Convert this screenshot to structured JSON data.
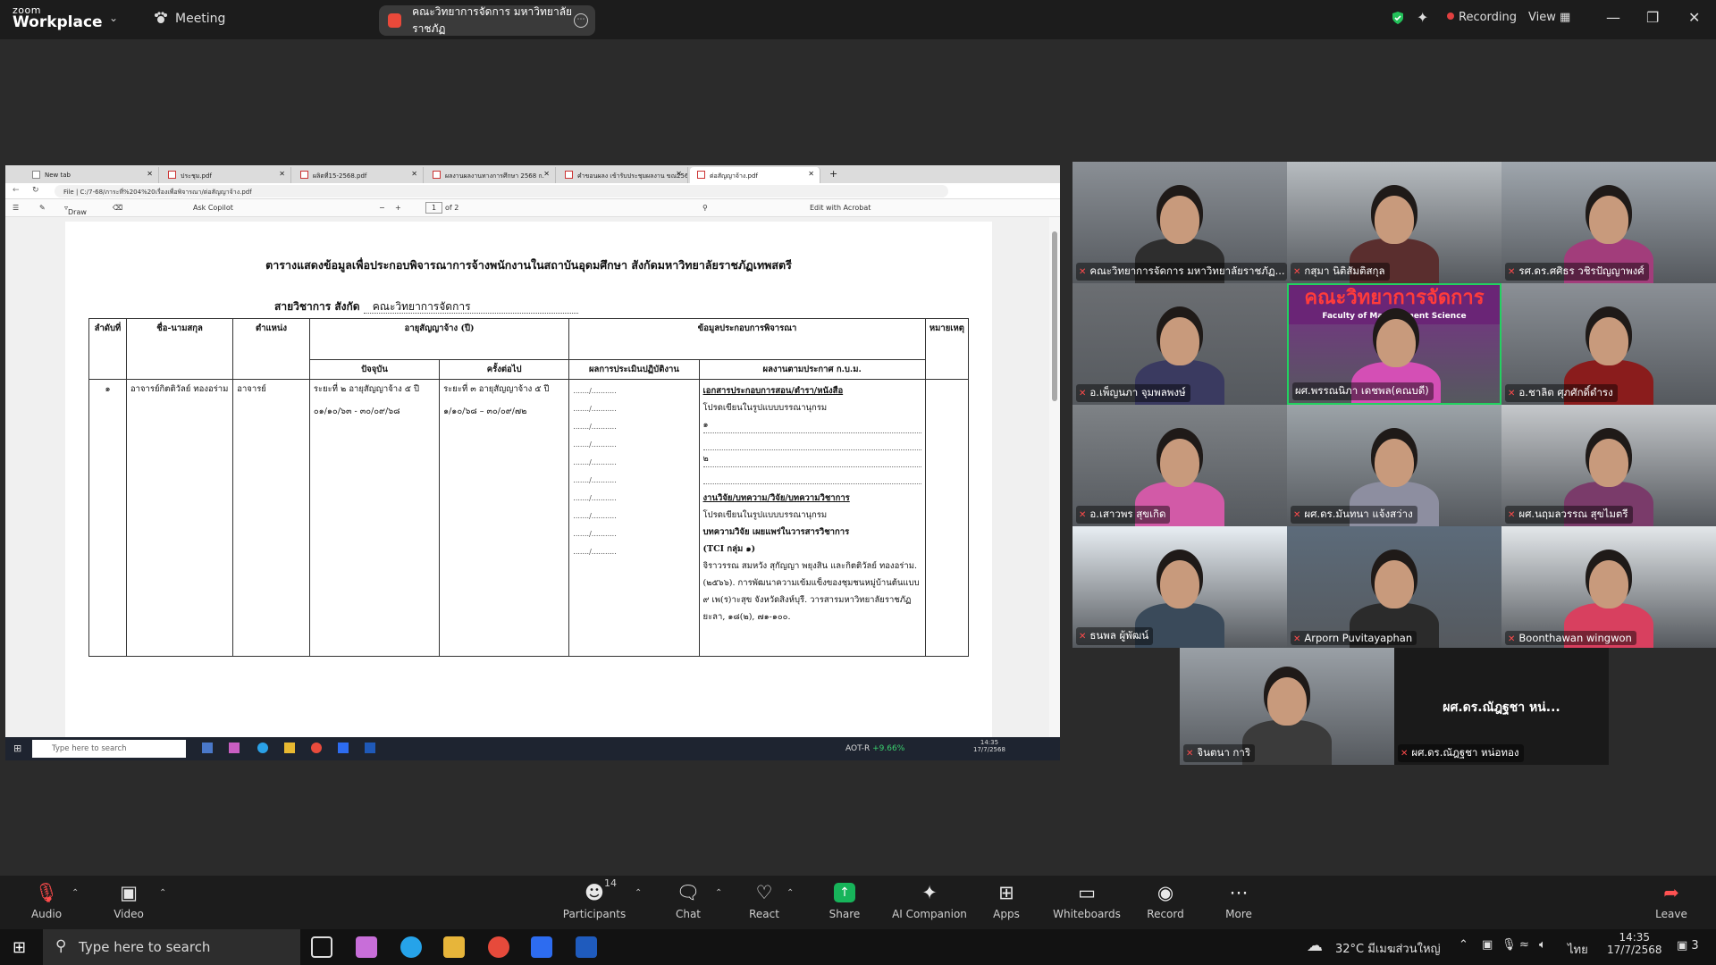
{
  "app": {
    "logo_top": "zoom",
    "logo_bottom": "Workplace",
    "meeting_label": "Meeting",
    "shared_tab_title": "คณะวิทยาการจัดการ มหาวิทยาลัยราชภัฏ",
    "recording_label": "Recording",
    "view_label": "View"
  },
  "browser": {
    "tabs": [
      "New tab",
      "ประชุม.pdf",
      "ผลิตที่15-2568.pdf",
      "ผลงานผลงานทางการศึกษา 2568 ก.",
      "คำขอนผลง เข้ารับประชุมผลงาน ขณ2568",
      "ต่อสัญญาจ้าง.pdf"
    ],
    "url": "C:/7-68/ภาระที่%204%20เรื่องเพื่อพิจารณา/ต่อสัญญาจ้าง.pdf",
    "file_label": "File",
    "draw_label": "Draw",
    "ask_copilot": "Ask Copilot",
    "page_num": "1",
    "page_of": "of 2",
    "edit_acrobat": "Edit with Acrobat"
  },
  "document": {
    "title": "ตารางแสดงข้อมูลเพื่อประกอบพิจารณาการจ้างพนักงานในสถาบันอุดมศึกษา สังกัดมหาวิทยาลัยราชภัฏเทพสตรี",
    "subtitle_prefix": "สายวิชาการ    สังกัด",
    "subtitle_value": "คณะวิทยาการจัดการ",
    "headers": {
      "order": "ลำดับที่",
      "name": "ชื่อ-นามสกุล",
      "position": "ตำแหน่ง",
      "contract": "อายุสัญญาจ้าง (ปี)",
      "current": "ปัจจุบัน",
      "next": "ครั้งต่อไป",
      "consider": "ข้อมูลประกอบการพิจารณา",
      "eval": "ผลการประเมินปฏิบัติงาน",
      "works": "ผลงานตามประกาศ ก.บ.ม.",
      "remark": "หมายเหตุ"
    },
    "row": {
      "order": "๑",
      "name": "อาจารย์กิตติวัลย์ ทองอร่าม",
      "position": "อาจารย์",
      "current_term": "ระยะที่ ๒ อายุสัญญาจ้าง ๕ ปี",
      "current_dates": "๐๑/๑๐/๖๓ - ๓๐/๐๙/๖๘",
      "next_term": "ระยะที่ ๓ อายุสัญญาจ้าง ๕ ปี",
      "next_dates": "๑/๑๐/๖๘ – ๓๐/๐๙/๗๒",
      "eval_line": "......./...........",
      "docs_heading": "เอกสารประกอบการสอน/ตำรา/หนังสือ",
      "docs_note": "โปรดเขียนในรูปแบบบรรณานุกรม",
      "item1": "๑",
      "item2": "๒",
      "research_heading": "งานวิจัย/บทความ/วิจัย/บทความวิชาการ",
      "research_note": "โปรดเขียนในรูปแบบบรรณานุกรม",
      "research_sub": "บทความวิจัย เผยแพร่ในวารสารวิชาการ",
      "research_group": "(TCI กลุ่ม ๑)",
      "citation": "จิราวรรณ สมหวัง สุกัญญา พยุงสิน และกิตติวัลย์ ทองอร่าม. (๒๕๖๖). การพัฒนาความเข้มแข็งของชุมชนหมู่บ้านต้นแบบ ๙ เพ(ร)าะสุข จังหวัดสิงห์บุรี. วารสารมหาวิทยาลัยราชภัฏยะลา, ๑๘(๒), ๗๑-๑๐๐."
    }
  },
  "remote_taskbar": {
    "search_placeholder": "Type here to search",
    "stock": "AOT-R",
    "stock_change": "+9.66%",
    "time": "14:35",
    "date": "17/7/2568"
  },
  "participants": [
    {
      "name": "คณะวิทยาการจัดการ มหาวิทยาลัยราชภัฏ...",
      "muted": true
    },
    {
      "name": "กสุมา นิติสัมติสกุล",
      "muted": true
    },
    {
      "name": "รศ.ดร.ศศิธร วชิรปัญญาพงศ์",
      "muted": true
    },
    {
      "name": "อ.เพ็ญนภา จุมพลพงษ์",
      "muted": true
    },
    {
      "name": "ผศ.พรรณนิภา เดชพล(คณบดี)",
      "muted": false,
      "banner": "คณะวิทยาการจัดการ",
      "banner_sub": "Faculty of Management Science"
    },
    {
      "name": "อ.ชาลิต ศุภศักดิ์ดำรง",
      "muted": true
    },
    {
      "name": "อ.เสาวพร สุขเกิด",
      "muted": true
    },
    {
      "name": "ผศ.ดร.มันทนา แจ้งสว่าง",
      "muted": true
    },
    {
      "name": "ผศ.นฤมลวรรณ สุขไมตรี",
      "muted": true
    },
    {
      "name": "ธนพล ผู้พัฒน์",
      "muted": true
    },
    {
      "name": "Arporn Puvitayaphan",
      "muted": true
    },
    {
      "name": "Boonthawan wingwon",
      "muted": true
    },
    {
      "name": "จินตนา การิ",
      "muted": true
    },
    {
      "name": "ผศ.ดร.ณัฎฐชา หน่อทอง",
      "muted": true,
      "display": "ผศ.ดร.ณัฎฐชา หน่..."
    }
  ],
  "controls": {
    "audio": "Audio",
    "video": "Video",
    "participants": "Participants",
    "participants_count": "14",
    "chat": "Chat",
    "react": "React",
    "share": "Share",
    "ai": "AI Companion",
    "apps": "Apps",
    "whiteboards": "Whiteboards",
    "record": "Record",
    "more": "More",
    "leave": "Leave"
  },
  "host_taskbar": {
    "search_placeholder": "Type here to search",
    "weather": "32°C มีเมฆส่วนใหญ่",
    "lang": "ไทย",
    "time": "14:35",
    "date": "17/7/2568",
    "notif": "3"
  }
}
